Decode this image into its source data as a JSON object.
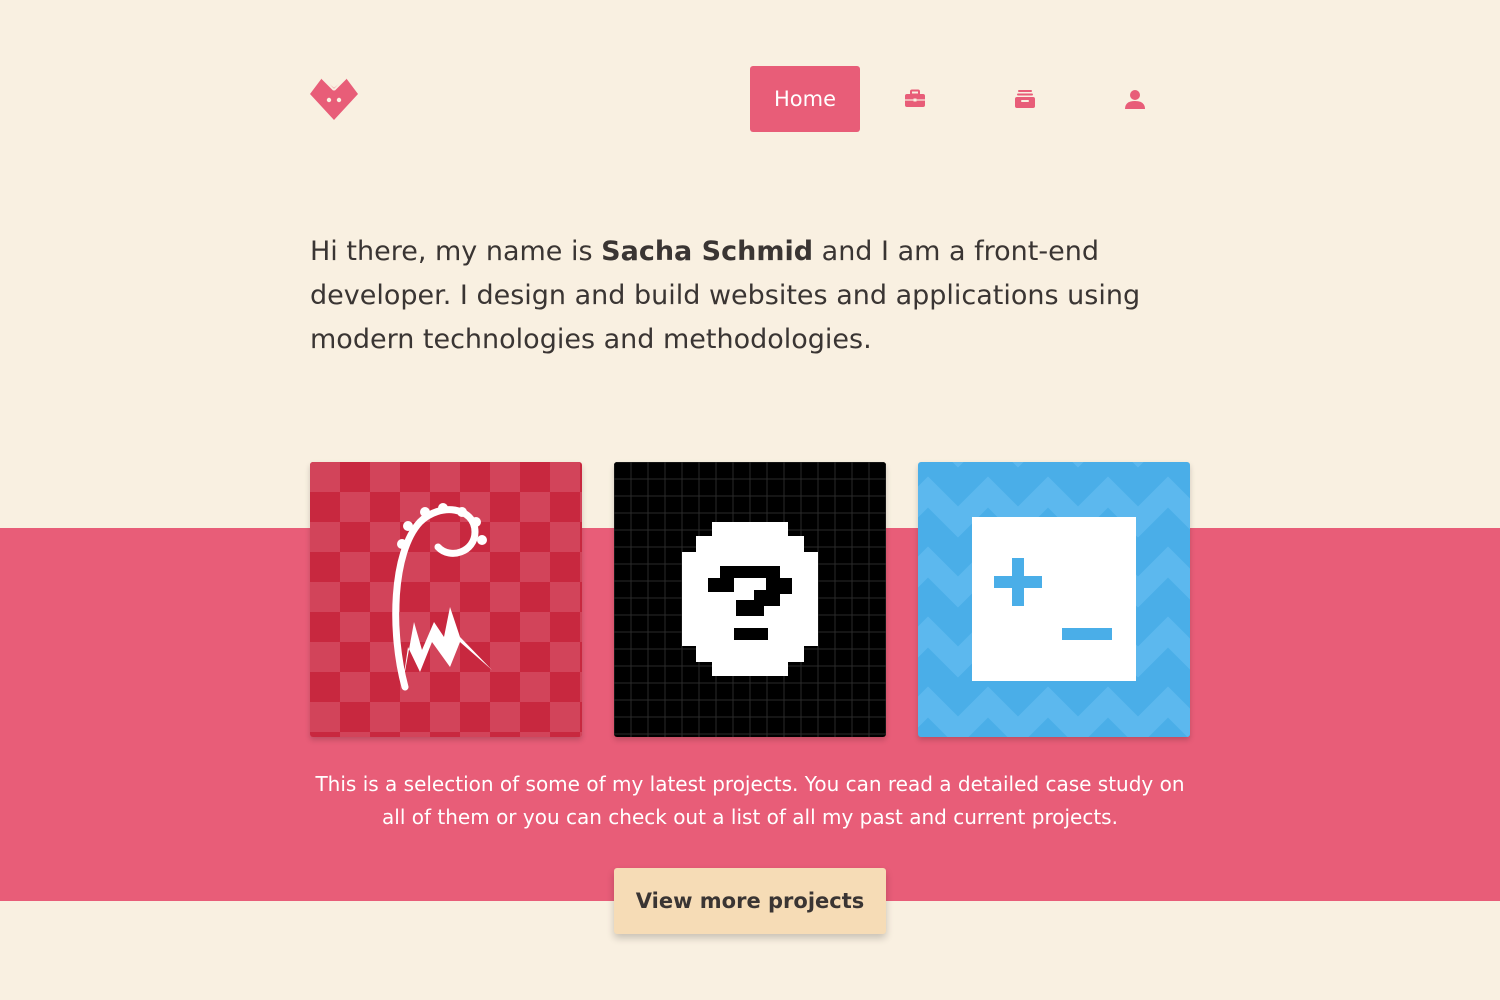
{
  "nav": {
    "home_label": "Home",
    "items": [
      {
        "icon": "briefcase-icon"
      },
      {
        "icon": "archive-icon"
      },
      {
        "icon": "user-icon"
      }
    ]
  },
  "intro": {
    "prefix": "Hi there, my name is ",
    "name": "Sacha Schmid",
    "suffix": " and I am a front-end developer. I design and build websites and applications using modern technologies and methodologies."
  },
  "projects": [
    {
      "icon": "ribbon-logo-icon",
      "color": "#c8283f"
    },
    {
      "icon": "pixel-question-icon",
      "color": "#000000"
    },
    {
      "icon": "plus-minus-icon",
      "color": "#4aaee8"
    }
  ],
  "caption": "This is a selection of some of my latest projects. You can read a detailed case study on all of them or you can check out a list of all my past and current projects.",
  "cta_label": "View more projects",
  "colors": {
    "accent": "#e85d78",
    "background": "#f9f0e1",
    "button": "#f6dcb6"
  }
}
